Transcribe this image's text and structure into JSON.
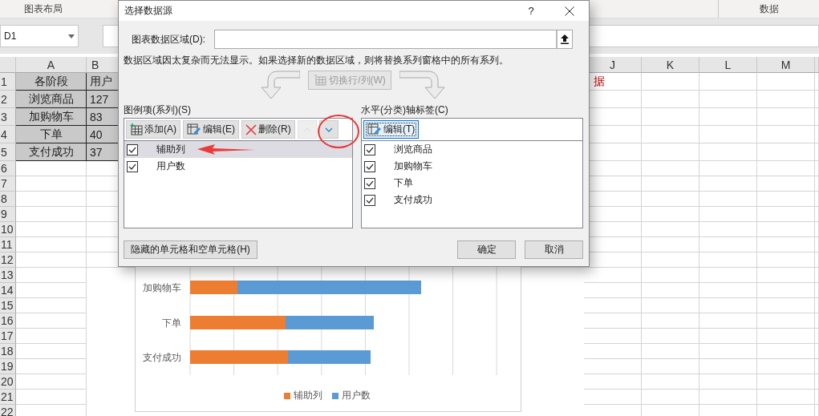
{
  "ribbon": {
    "tabs": [
      "图表布局",
      "数据"
    ]
  },
  "name_box": "D1",
  "sheet": {
    "columns": [
      {
        "label": "A"
      },
      {
        "label": "B"
      },
      {
        "label": "J"
      },
      {
        "label": "K"
      },
      {
        "label": "L"
      },
      {
        "label": "M"
      }
    ],
    "rows": [
      {
        "number": "1",
        "highlighted": true,
        "cells": [
          "各阶段",
          "用户",
          "据"
        ]
      },
      {
        "number": "2",
        "highlighted": true,
        "cells": [
          "浏览商品",
          "127"
        ]
      },
      {
        "number": "3",
        "highlighted": true,
        "cells": [
          "加购物车",
          "83"
        ]
      },
      {
        "number": "4",
        "highlighted": true,
        "cells": [
          "下单",
          "40"
        ]
      },
      {
        "number": "5",
        "highlighted": true,
        "cells": [
          "支付成功",
          "37"
        ]
      },
      {
        "number": "6",
        "highlighted": false
      },
      {
        "number": "7",
        "highlighted": false
      },
      {
        "number": "8",
        "highlighted": false
      },
      {
        "number": "9",
        "highlighted": false
      },
      {
        "number": "10",
        "highlighted": false
      },
      {
        "number": "11",
        "highlighted": false
      },
      {
        "number": "12",
        "highlighted": false
      },
      {
        "number": "13",
        "highlighted": false
      },
      {
        "number": "14",
        "highlighted": false
      },
      {
        "number": "15",
        "highlighted": false
      },
      {
        "number": "16",
        "highlighted": false
      },
      {
        "number": "17",
        "highlighted": false
      },
      {
        "number": "18",
        "highlighted": false
      },
      {
        "number": "19",
        "highlighted": false
      },
      {
        "number": "20",
        "highlighted": false
      },
      {
        "number": "21",
        "highlighted": false
      },
      {
        "number": "22",
        "highlighted": false
      }
    ]
  },
  "chart": {
    "categories": [
      "加购物车",
      "下单",
      "支付成功"
    ],
    "legend": [
      {
        "label": "辅助列",
        "color": "#ed7d31"
      },
      {
        "label": "用户数",
        "color": "#5b9bd5"
      }
    ]
  },
  "dialog": {
    "title": "选择数据源",
    "help": "?",
    "range_label": "图表数据区域(D):",
    "message": "数据区域因太复杂而无法显示。如果选择新的数据区域，则将替换系列窗格中的所有系列。",
    "switch_button": {
      "label": "切换行/列(W)",
      "disabled": true
    },
    "series": {
      "label": "图例项(系列)(S)",
      "buttons": [
        {
          "kind": "add",
          "label": "添加(A)",
          "disabled": false
        },
        {
          "kind": "edit",
          "label": "编辑(E)",
          "disabled": false
        },
        {
          "kind": "remove",
          "label": "删除(R)",
          "disabled": false
        },
        {
          "kind": "up",
          "disabled": true
        },
        {
          "kind": "down",
          "disabled": false
        }
      ],
      "items": [
        {
          "label": "辅助列",
          "checked": true,
          "selected": true
        },
        {
          "label": "用户数",
          "checked": true,
          "selected": false
        }
      ]
    },
    "categories": {
      "label": "水平(分类)轴标签(C)",
      "edit_button": {
        "label": "编辑(T)",
        "focused": true
      },
      "items": [
        {
          "label": "浏览商品",
          "checked": true
        },
        {
          "label": "加购物车",
          "checked": true
        },
        {
          "label": "下单",
          "checked": true
        },
        {
          "label": "支付成功",
          "checked": true
        }
      ]
    },
    "hidden_cells_button": "隐藏的单元格和空单元格(H)",
    "ok_button": "确定",
    "cancel_button": "取消"
  }
}
